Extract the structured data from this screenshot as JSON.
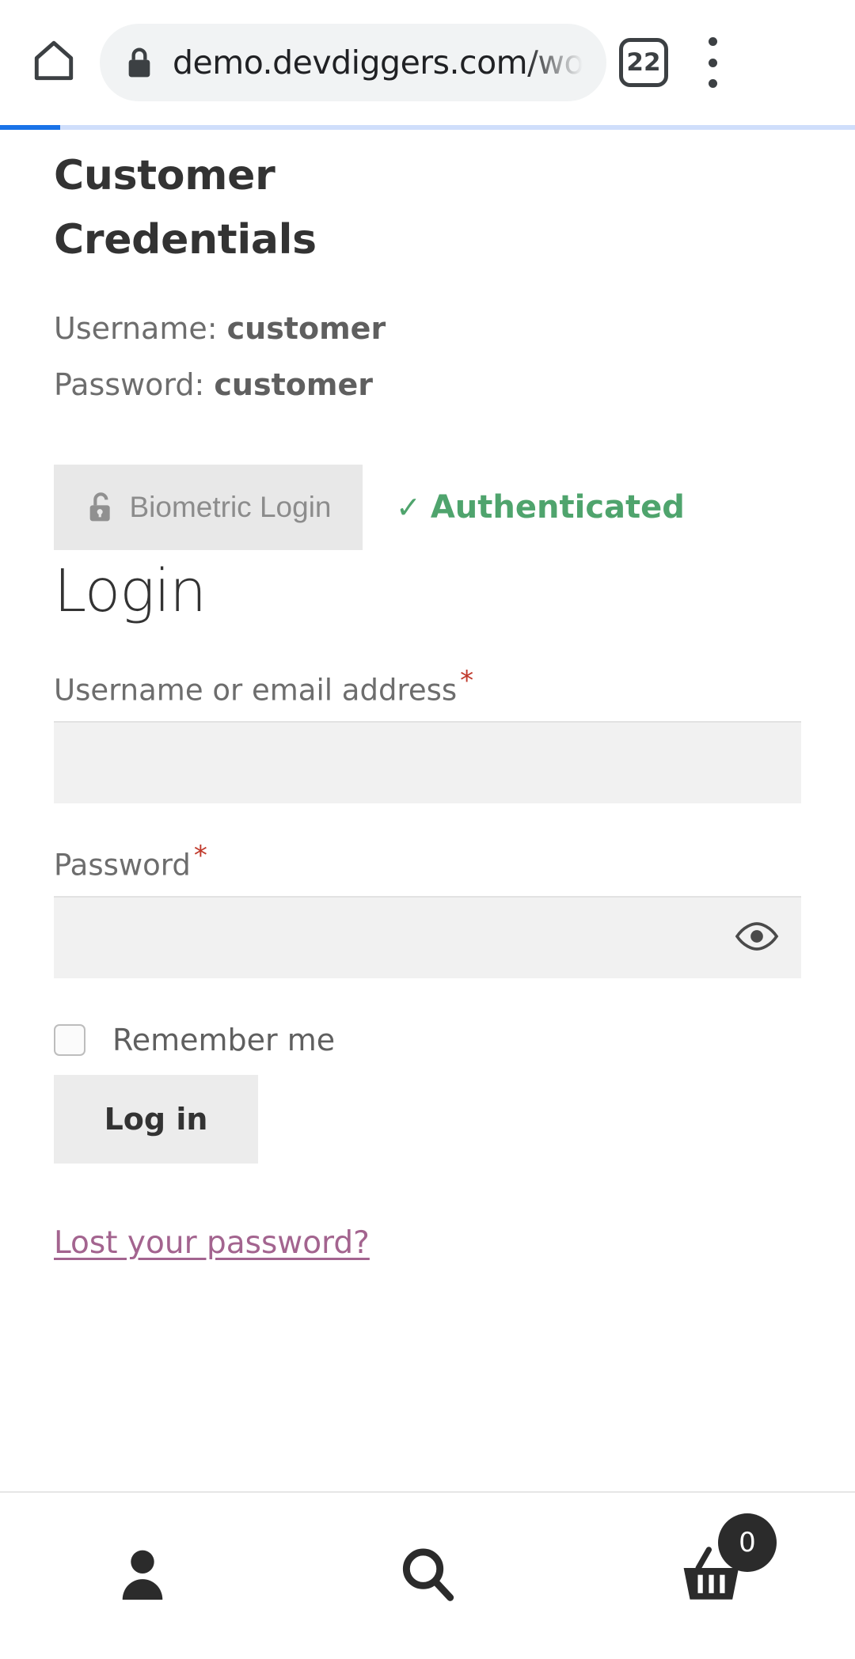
{
  "browser": {
    "home_icon": "home-icon",
    "lock_icon": "lock-icon",
    "url": "demo.devdiggers.com/woo",
    "tab_count": "22",
    "menu_icon": "overflow-menu-icon",
    "progress_percent": "7"
  },
  "content": {
    "credentials_title": "Customer Credentials",
    "username_line_label": "Username:",
    "username_line_value": "customer",
    "password_line_label": "Password:",
    "password_line_value": "customer",
    "biometric": {
      "icon": "unlock-icon",
      "label": "Biometric Login",
      "status_check": "✓",
      "status_text": "Authenticated",
      "status_color": "#4fa46d"
    },
    "login_heading": "Login",
    "form": {
      "username_label": "Username or email address",
      "username_required": "*",
      "username_value": "",
      "username_placeholder": "",
      "password_label": "Password",
      "password_required": "*",
      "password_value": "",
      "password_placeholder": "",
      "toggle_password_icon": "eye-icon",
      "remember_label": "Remember me",
      "remember_checked": false,
      "submit_label": "Log in",
      "lost_password_label": "Lost your password?",
      "link_color": "#a3648f"
    }
  },
  "bottom_nav": {
    "items": [
      {
        "icon": "account-icon",
        "name": "account"
      },
      {
        "icon": "search-icon",
        "name": "search"
      },
      {
        "icon": "cart-icon",
        "name": "cart"
      }
    ],
    "cart_count": "0"
  }
}
